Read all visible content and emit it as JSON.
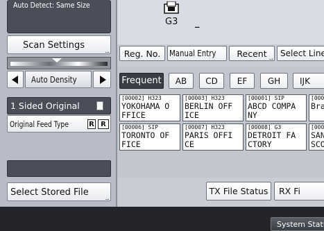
{
  "left": {
    "auto_detect": "Auto Detect: Same Size",
    "scan_settings": "Scan Settings",
    "auto_density": "Auto Density",
    "sided_original": "1 Sided Original",
    "feed_type": "Original Feed Type",
    "select_stored_file": "Select Stored File"
  },
  "top": {
    "line": "G3",
    "cursor": "_"
  },
  "search_tabs": [
    "Reg. No.",
    "Manual Entry",
    "Recent",
    "Select Line"
  ],
  "index_tabs": [
    "Frequent",
    "AB",
    "CD",
    "EF",
    "GH",
    "IJK"
  ],
  "destinations": [
    {
      "code": "[00002] H323",
      "name": "YOKOHAMA O\nFFICE"
    },
    {
      "code": "[00003] H323",
      "name": "BERLIN OFF\nICE"
    },
    {
      "code": "[00001] SIP",
      "name": "ABCD COMPA\nNY"
    },
    {
      "code": "[0000",
      "name": "Bra"
    },
    {
      "code": "[00006] SIP",
      "name": "TORONTO OF\nFICE"
    },
    {
      "code": "[00007] H323",
      "name": "PARIS OFFI\nCE"
    },
    {
      "code": "[00008] G3",
      "name": "DETROIT FA\nCTORY"
    },
    {
      "code": "[0000",
      "name": "SAN\nSCO"
    }
  ],
  "bottom_buttons": {
    "tx_status": "TX File Status",
    "rx_file": "RX Fi"
  },
  "status_bar": {
    "system_status": "System Statu"
  },
  "colors": {
    "selected_tab": "#3a3d45",
    "panel": "#4a4e58"
  }
}
